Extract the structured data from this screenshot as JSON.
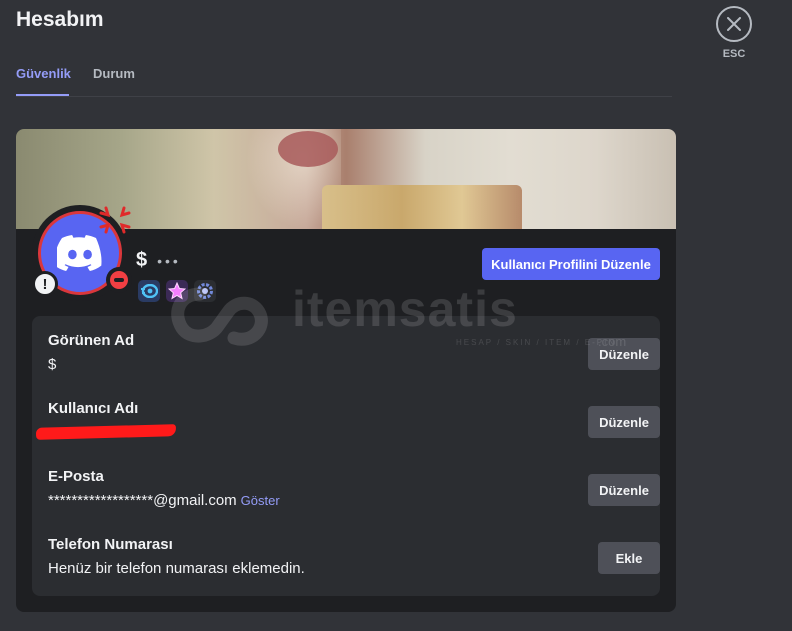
{
  "page": {
    "title": "Hesabım"
  },
  "tabs": [
    {
      "label": "Güvenlik",
      "active": true
    },
    {
      "label": "Durum",
      "active": false
    }
  ],
  "close": {
    "label": "ESC",
    "icon": "close-icon"
  },
  "profile": {
    "display_name": "$",
    "status_dots": "•••",
    "edit_profile_label": "Kullanıcı Profilini Düzenle",
    "badges": [
      "nitro-badge",
      "boost-badge",
      "hypesquad-badge"
    ],
    "avatar_status": "do-not-disturb",
    "accent_color": "#5865f2"
  },
  "fields": [
    {
      "label": "Görünen Ad",
      "value": "$",
      "button": "Düzenle"
    },
    {
      "label": "Kullanıcı Adı",
      "value": "",
      "button": "Düzenle"
    },
    {
      "label": "E-Posta",
      "value": "******************@gmail.com",
      "reveal": "Göster",
      "button": "Düzenle"
    },
    {
      "label": "Telefon Numarası",
      "value": "Henüz bir telefon numarası eklemedin.",
      "button": "Ekle"
    }
  ],
  "watermark": {
    "text": "itemsatis",
    "sub": "HESAP / SKIN / ITEM / E-PIN",
    "suffix": ".com"
  }
}
